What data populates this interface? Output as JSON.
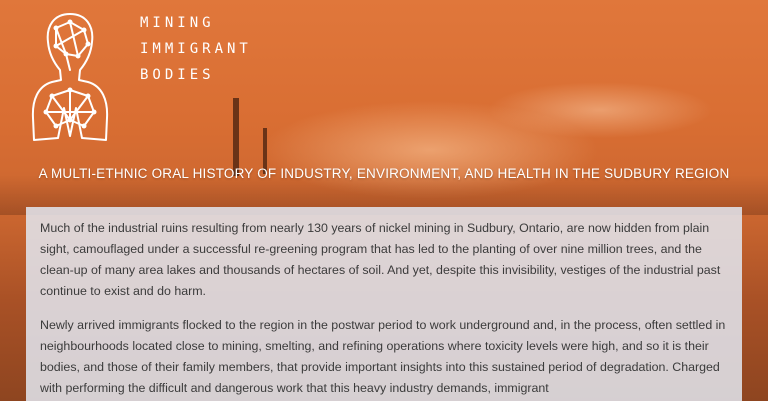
{
  "header": {
    "brand_line1": "MINING",
    "brand_line2": "IMMIGRANT",
    "brand_line3": "BODIES",
    "tagline": "A MULTI-ETHNIC ORAL HISTORY OF INDUSTRY, ENVIRONMENT, AND HEALTH IN THE SUDBURY REGION",
    "logo_icon": "head-and-torso-network-icon"
  },
  "content": {
    "paragraph1": "Much of the industrial ruins resulting from nearly 130 years of nickel mining in Sudbury, Ontario, are now hidden from plain sight, camouflaged under a successful re-greening program that has led to the planting of over nine million trees, and the clean-up of many area lakes and thousands of hectares of soil. And yet, despite this invisibility, vestiges of the industrial past continue to exist and do harm.",
    "paragraph2": "Newly arrived immigrants flocked to the region in the postwar period to work underground and, in the process, often settled in neighbourhoods located close to mining, smelting, and refining operations where toxicity levels were high, and so it is their bodies, and those of their family members, that provide important insights into this sustained period of degradation. Charged with performing the difficult and dangerous work that this heavy industry demands, immigrant"
  },
  "colors": {
    "hero_orange": "#d96e33",
    "panel_bg": "#e2e7f0",
    "text": "#3b3b3b",
    "white": "#ffffff"
  }
}
